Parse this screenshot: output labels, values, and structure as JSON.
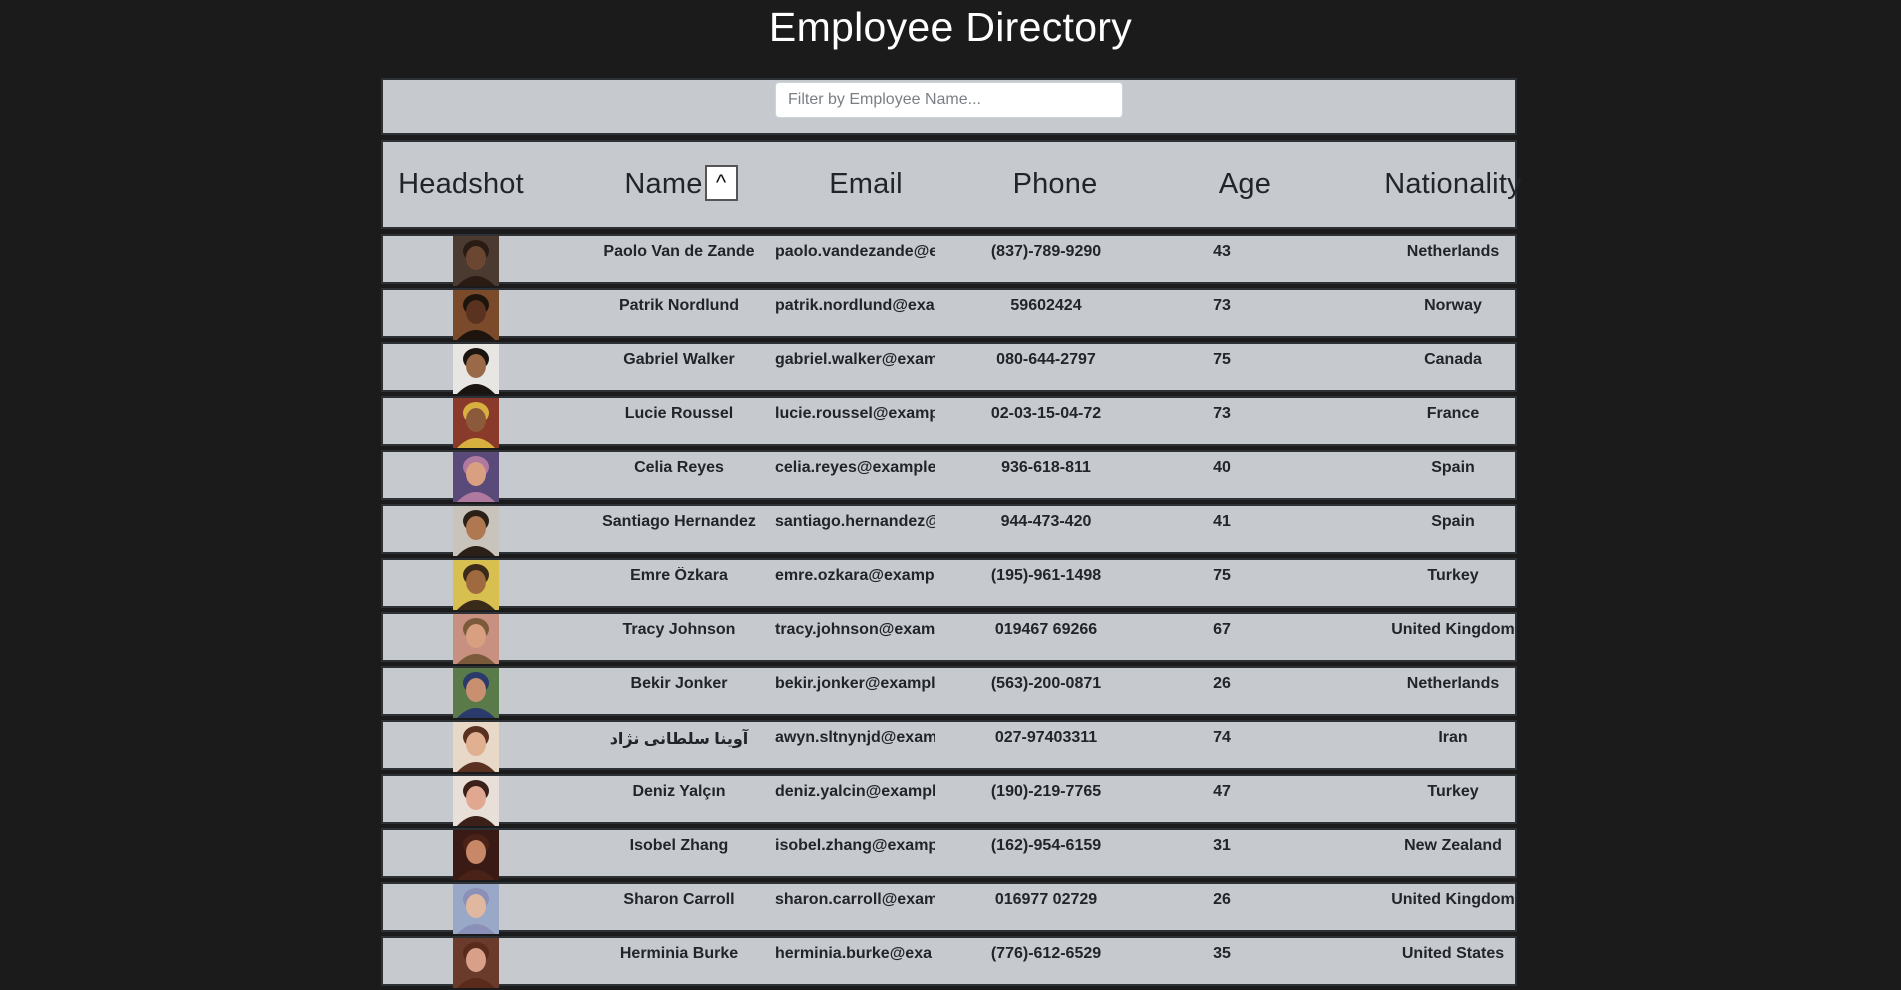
{
  "page": {
    "title": "Employee Directory"
  },
  "filter": {
    "placeholder": "Filter by Employee Name..."
  },
  "table": {
    "headers": {
      "headshot": "Headshot",
      "name": "Name",
      "email": "Email",
      "phone": "Phone",
      "age": "Age",
      "nationality": "Nationality"
    },
    "sort_label": "^",
    "rows": [
      {
        "name": "Paolo Van de Zande",
        "email": "paolo.vandezande@e",
        "phone": "(837)-789-9290",
        "age": "43",
        "nationality": "Netherlands",
        "avatar_bg": "#4a3a30",
        "avatar_skin": "#6b4630",
        "avatar_hair": "#2a1c14"
      },
      {
        "name": "Patrik Nordlund",
        "email": "patrik.nordlund@exa",
        "phone": "59602424",
        "age": "73",
        "nationality": "Norway",
        "avatar_bg": "#7a4a2a",
        "avatar_skin": "#5a3220",
        "avatar_hair": "#1e140e"
      },
      {
        "name": "Gabriel Walker",
        "email": "gabriel.walker@exam",
        "phone": "080-644-2797",
        "age": "75",
        "nationality": "Canada",
        "avatar_bg": "#e8e6e2",
        "avatar_skin": "#9a6a48",
        "avatar_hair": "#1a1410"
      },
      {
        "name": "Lucie Roussel",
        "email": "lucie.roussel@examp",
        "phone": "02-03-15-04-72",
        "age": "73",
        "nationality": "France",
        "avatar_bg": "#8a3a2a",
        "avatar_skin": "#8a5a3a",
        "avatar_hair": "#d8b040"
      },
      {
        "name": "Celia Reyes",
        "email": "celia.reyes@example.",
        "phone": "936-618-811",
        "age": "40",
        "nationality": "Spain",
        "avatar_bg": "#5a4a7a",
        "avatar_skin": "#d8a080",
        "avatar_hair": "#b07aa0"
      },
      {
        "name": "Santiago Hernandez",
        "email": "santiago.hernandez@",
        "phone": "944-473-420",
        "age": "41",
        "nationality": "Spain",
        "avatar_bg": "#c8c4bc",
        "avatar_skin": "#b07850",
        "avatar_hair": "#2a2018"
      },
      {
        "name": "Emre Özkara",
        "email": "emre.ozkara@examp",
        "phone": "(195)-961-1498",
        "age": "75",
        "nationality": "Turkey",
        "avatar_bg": "#d8c050",
        "avatar_skin": "#a06a40",
        "avatar_hair": "#3a2a1a"
      },
      {
        "name": "Tracy Johnson",
        "email": "tracy.johnson@exam",
        "phone": "019467 69266",
        "age": "67",
        "nationality": "United Kingdom",
        "avatar_bg": "#c89080",
        "avatar_skin": "#d8a080",
        "avatar_hair": "#7a5a3a"
      },
      {
        "name": "Bekir Jonker",
        "email": "bekir.jonker@exampl",
        "phone": "(563)-200-0871",
        "age": "26",
        "nationality": "Netherlands",
        "avatar_bg": "#5a7a4a",
        "avatar_skin": "#c89070",
        "avatar_hair": "#2a3a6a"
      },
      {
        "name": "آوینا سلطانی نژاد",
        "email": "awyn.sltnynjd@exam",
        "phone": "027-97403311",
        "age": "74",
        "nationality": "Iran",
        "avatar_bg": "#e8d8c8",
        "avatar_skin": "#e0b090",
        "avatar_hair": "#5a3020"
      },
      {
        "name": "Deniz Yalçın",
        "email": "deniz.yalcin@exampl",
        "phone": "(190)-219-7765",
        "age": "47",
        "nationality": "Turkey",
        "avatar_bg": "#e8e0d8",
        "avatar_skin": "#e0a890",
        "avatar_hair": "#3a2018"
      },
      {
        "name": "Isobel Zhang",
        "email": "isobel.zhang@examp",
        "phone": "(162)-954-6159",
        "age": "31",
        "nationality": "New Zealand",
        "avatar_bg": "#3a1a14",
        "avatar_skin": "#c88868",
        "avatar_hair": "#4a2218"
      },
      {
        "name": "Sharon Carroll",
        "email": "sharon.carroll@exam",
        "phone": "016977 02729",
        "age": "26",
        "nationality": "United Kingdom",
        "avatar_bg": "#9aa8c8",
        "avatar_skin": "#e0b8a0",
        "avatar_hair": "#8a90b8"
      },
      {
        "name": "Herminia Burke",
        "email": "herminia.burke@exa",
        "phone": "(776)-612-6529",
        "age": "35",
        "nationality": "United States",
        "avatar_bg": "#6a3a2a",
        "avatar_skin": "#d8a088",
        "avatar_hair": "#5a2a1a"
      }
    ]
  }
}
